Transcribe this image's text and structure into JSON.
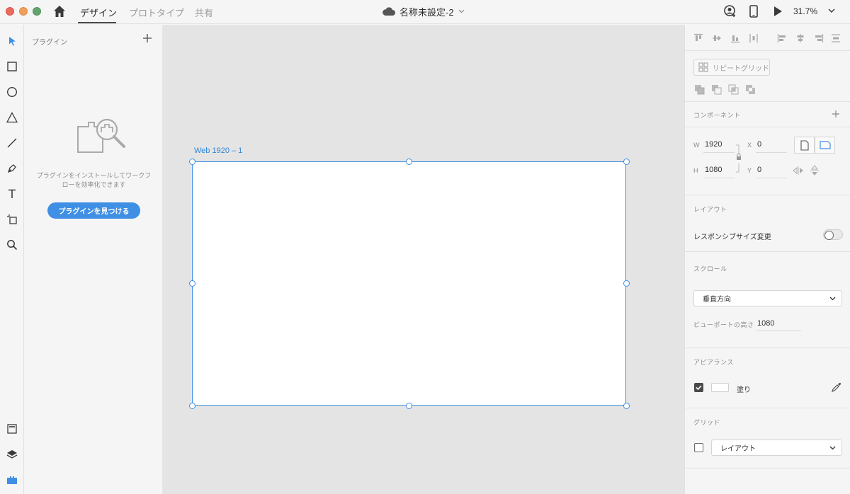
{
  "app": {
    "tabs": [
      {
        "label": "デザイン",
        "active": true
      },
      {
        "label": "プロトタイプ",
        "active": false
      },
      {
        "label": "共有",
        "active": false
      }
    ],
    "document_title": "名称未設定-2",
    "zoom": "31.7%"
  },
  "tools": [
    "select-icon",
    "rectangle-icon",
    "ellipse-icon",
    "triangle-icon",
    "line-icon",
    "pen-icon",
    "text-icon",
    "artboard-icon",
    "zoom-icon",
    "assets-icon",
    "layers-icon",
    "plugins-icon"
  ],
  "plugins_panel": {
    "title": "プラグイン",
    "message_line1": "プラグインをインストールしてワークフ",
    "message_line2": "ローを効率化できます",
    "button_label": "プラグインを見つける"
  },
  "canvas": {
    "artboard_label": "Web 1920 – 1"
  },
  "properties": {
    "repeat_grid_label": "リピートグリッド",
    "components_label": "コンポーネント",
    "w_label": "W",
    "w_value": "1920",
    "h_label": "H",
    "h_value": "1080",
    "x_label": "X",
    "x_value": "0",
    "y_label": "Y",
    "y_value": "0",
    "layout_section": "レイアウト",
    "responsive_label": "レスポンシブサイズ変更",
    "responsive_on": false,
    "scroll_section": "スクロール",
    "scroll_value": "垂直方向",
    "viewport_label": "ビューポートの高さ",
    "viewport_value": "1080",
    "appearance_section": "アピアランス",
    "fill_label": "塗り",
    "fill_checked": true,
    "fill_color": "#FFFFFF",
    "grid_section": "グリッド",
    "grid_value": "レイアウト",
    "grid_checked": false
  },
  "colors": {
    "accent": "#3F8FE5",
    "canvas_bg": "#E4E4E4",
    "panel_bg": "#F5F5F5"
  }
}
